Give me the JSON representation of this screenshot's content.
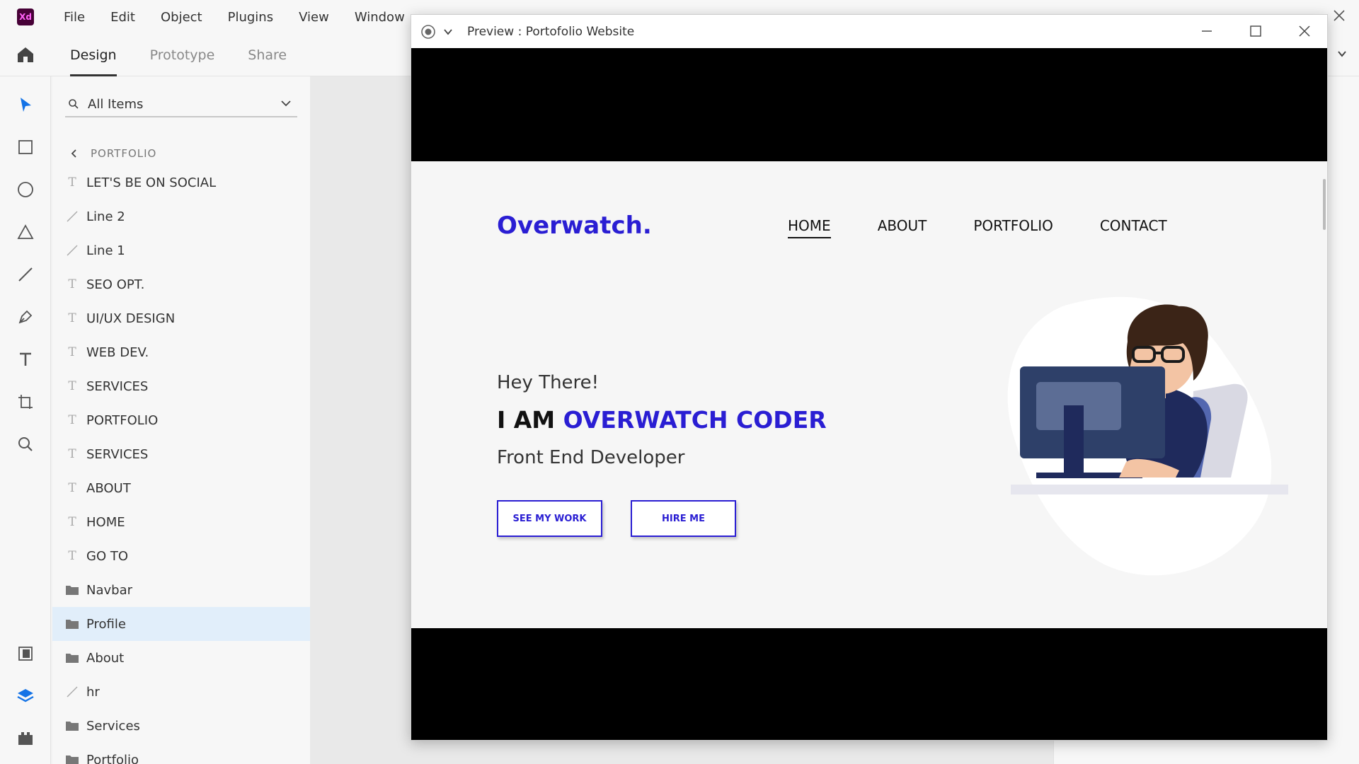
{
  "app": {
    "logo_text": "Xd",
    "menu": [
      "File",
      "Edit",
      "Object",
      "Plugins",
      "View",
      "Window"
    ],
    "tabs": [
      {
        "label": "Design",
        "active": true
      },
      {
        "label": "Prototype",
        "active": false
      },
      {
        "label": "Share",
        "active": false
      }
    ]
  },
  "toolbar": {
    "tools": [
      "select-tool-icon",
      "rectangle-tool-icon",
      "ellipse-tool-icon",
      "polygon-tool-icon",
      "line-tool-icon",
      "pen-tool-icon",
      "text-tool-icon",
      "artboard-tool-icon",
      "zoom-tool-icon"
    ],
    "bottom": [
      "assets-icon",
      "layers-icon",
      "plugins-icon"
    ],
    "accent_color": "#1473e6"
  },
  "layers": {
    "search_value": "All Items",
    "breadcrumb": "PORTFOLIO",
    "items": [
      {
        "label": "LET'S BE ON SOCIAL",
        "type": "text"
      },
      {
        "label": "Line 2",
        "type": "line"
      },
      {
        "label": "Line 1",
        "type": "line"
      },
      {
        "label": "SEO OPT.",
        "type": "text"
      },
      {
        "label": "UI/UX DESIGN",
        "type": "text"
      },
      {
        "label": "WEB DEV.",
        "type": "text"
      },
      {
        "label": "SERVICES",
        "type": "text"
      },
      {
        "label": "PORTFOLIO",
        "type": "text"
      },
      {
        "label": "SERVICES",
        "type": "text"
      },
      {
        "label": "ABOUT",
        "type": "text"
      },
      {
        "label": "HOME",
        "type": "text"
      },
      {
        "label": "GO TO",
        "type": "text"
      },
      {
        "label": "Navbar",
        "type": "group"
      },
      {
        "label": "Profile",
        "type": "group",
        "selected": true
      },
      {
        "label": "About",
        "type": "group"
      },
      {
        "label": "hr",
        "type": "line"
      },
      {
        "label": "Services",
        "type": "group"
      },
      {
        "label": "Portfolio",
        "type": "group"
      }
    ]
  },
  "preview": {
    "title": "Preview : Portofolio Website",
    "site": {
      "logo": "Overwatch.",
      "nav": [
        "HOME",
        "ABOUT",
        "PORTFOLIO",
        "CONTACT"
      ],
      "nav_active": "HOME",
      "greeting": "Hey There!",
      "intro_prefix": "I AM ",
      "intro_name": "OVERWATCH CODER",
      "role": "Front End Developer",
      "buttons": [
        "SEE MY WORK",
        "HIRE ME"
      ],
      "brand_color": "#2a1ed3"
    }
  }
}
